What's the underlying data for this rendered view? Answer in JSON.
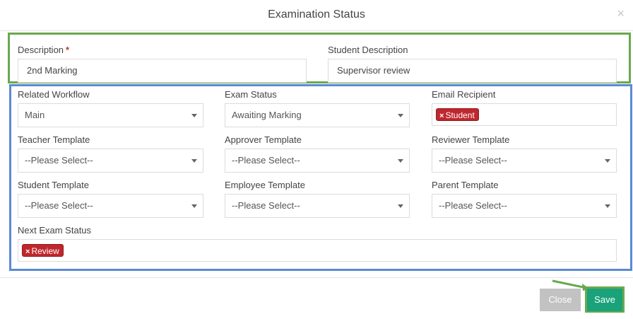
{
  "modal": {
    "title": "Examination Status",
    "close_glyph": "×"
  },
  "fields": {
    "description": {
      "label": "Description",
      "required_mark": "*",
      "value": "2nd Marking"
    },
    "student_description": {
      "label": "Student Description",
      "value": "Supervisor review"
    },
    "related_workflow": {
      "label": "Related Workflow",
      "value": "Main"
    },
    "exam_status": {
      "label": "Exam Status",
      "value": "Awaiting Marking"
    },
    "email_recipient": {
      "label": "Email Recipient",
      "tag": "Student"
    },
    "teacher_template": {
      "label": "Teacher Template",
      "value": "--Please Select--"
    },
    "approver_template": {
      "label": "Approver Template",
      "value": "--Please Select--"
    },
    "reviewer_template": {
      "label": "Reviewer Template",
      "value": "--Please Select--"
    },
    "student_template": {
      "label": "Student Template",
      "value": "--Please Select--"
    },
    "employee_template": {
      "label": "Employee Template",
      "value": "--Please Select--"
    },
    "parent_template": {
      "label": "Parent Template",
      "value": "--Please Select--"
    },
    "next_exam_status": {
      "label": "Next Exam Status",
      "tag": "Review"
    }
  },
  "tag_remove_glyph": "×",
  "footer": {
    "close_label": "Close",
    "save_label": "Save"
  },
  "colors": {
    "highlight_green": "#6aa84f",
    "highlight_blue": "#5b8bd1",
    "tag_red": "#c0272d",
    "save_green": "#1aa37a",
    "close_gray": "#c2c2c2",
    "required_red": "#c0392b"
  }
}
